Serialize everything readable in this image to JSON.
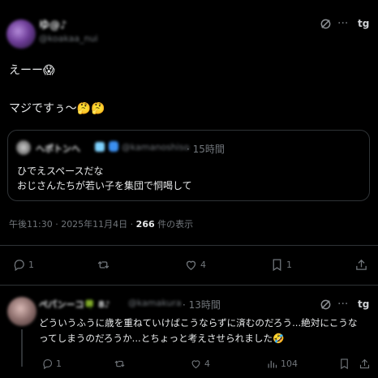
{
  "post": {
    "author_name": "ゆ@♪",
    "author_handle": "@koakaa_nui",
    "text_line1": "えーー😱",
    "text_line2": "マジですぅ～🤔🤔",
    "quote": {
      "author_name": "ヘポトンへ",
      "author_handle": "@kamanoshiso",
      "time": "· 15時間",
      "text_line1": "ひでえスペースだな",
      "text_line2": "おじさんたちが若い子を集団で恫喝して"
    },
    "meta": {
      "timestamp": "午後11:30 · 2025年11月4日 · ",
      "views_count": "266",
      "views_label": " 件の表示"
    },
    "actions": {
      "reply_count": "1",
      "retweet_count": "",
      "like_count": "4",
      "bookmark_count": "1"
    }
  },
  "reply": {
    "author_name": "ペパンーコ🍀 8♪",
    "author_handle": "@kamakura",
    "time": "· 13時間",
    "text_line1": "どういうふうに歳を重ねていけばこうならずに済むのだろう...絶対にこうな",
    "text_line2": "ってしまうのだろうか...とちょっと考えさせられました🤣",
    "actions": {
      "reply_count": "1",
      "retweet_count": "",
      "like_count": "4",
      "views_count": "104"
    }
  },
  "icons": {
    "grok": "grok-icon",
    "more": "more-icon",
    "x_logo": "x-logo-icon",
    "reply": "reply-icon",
    "retweet": "retweet-icon",
    "like": "like-icon",
    "bookmark": "bookmark-icon",
    "share": "share-icon",
    "views": "views-icon"
  },
  "colors": {
    "background": "#000000",
    "text": "#e7e9ea",
    "muted": "#71767b",
    "border": "#2f3336"
  }
}
